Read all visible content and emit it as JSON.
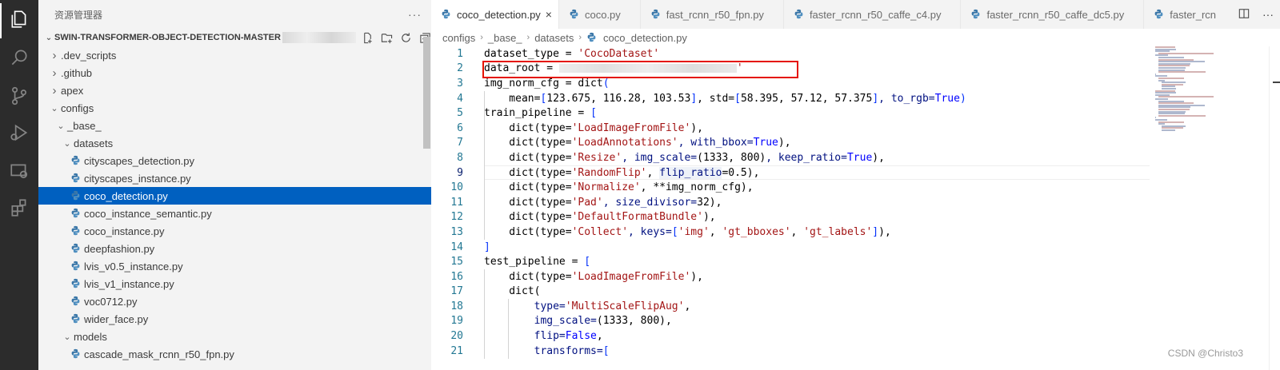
{
  "activity_bar": {
    "icons": [
      "explorer-icon",
      "search-icon",
      "source-control-icon",
      "run-debug-icon",
      "remote-explorer-icon",
      "extensions-icon"
    ]
  },
  "sidebar": {
    "title": "资源管理器",
    "more": "···",
    "project": "SWIN-TRANSFORMER-OBJECT-DETECTION-MASTER",
    "tree": [
      {
        "label": ".dev_scripts",
        "type": "folder",
        "expanded": false,
        "depth": 1
      },
      {
        "label": ".github",
        "type": "folder",
        "expanded": false,
        "depth": 1
      },
      {
        "label": "apex",
        "type": "folder",
        "expanded": false,
        "depth": 1
      },
      {
        "label": "configs",
        "type": "folder",
        "expanded": true,
        "depth": 1
      },
      {
        "label": "_base_",
        "type": "folder",
        "expanded": true,
        "depth": 2
      },
      {
        "label": "datasets",
        "type": "folder",
        "expanded": true,
        "depth": 3
      },
      {
        "label": "cityscapes_detection.py",
        "type": "file",
        "depth": 4
      },
      {
        "label": "cityscapes_instance.py",
        "type": "file",
        "depth": 4
      },
      {
        "label": "coco_detection.py",
        "type": "file",
        "depth": 4,
        "selected": true
      },
      {
        "label": "coco_instance_semantic.py",
        "type": "file",
        "depth": 4
      },
      {
        "label": "coco_instance.py",
        "type": "file",
        "depth": 4
      },
      {
        "label": "deepfashion.py",
        "type": "file",
        "depth": 4
      },
      {
        "label": "lvis_v0.5_instance.py",
        "type": "file",
        "depth": 4
      },
      {
        "label": "lvis_v1_instance.py",
        "type": "file",
        "depth": 4
      },
      {
        "label": "voc0712.py",
        "type": "file",
        "depth": 4
      },
      {
        "label": "wider_face.py",
        "type": "file",
        "depth": 4
      },
      {
        "label": "models",
        "type": "folder",
        "expanded": true,
        "depth": 3
      },
      {
        "label": "cascade_mask_rcnn_r50_fpn.py",
        "type": "file",
        "depth": 4
      }
    ]
  },
  "editor": {
    "tabs": [
      {
        "label": "coco_detection.py",
        "active": true,
        "close": "×"
      },
      {
        "label": "coco.py"
      },
      {
        "label": "fast_rcnn_r50_fpn.py"
      },
      {
        "label": "faster_rcnn_r50_caffe_c4.py"
      },
      {
        "label": "faster_rcnn_r50_caffe_dc5.py"
      },
      {
        "label": "faster_rcn"
      }
    ],
    "tab_actions": [
      "split-editor-icon",
      "more-actions-icon"
    ],
    "breadcrumb": [
      "configs",
      "_base_",
      "datasets",
      "coco_detection.py"
    ],
    "active_line": 9,
    "lines": [
      {
        "n": "1",
        "tokens": [
          [
            "dataset_type = ",
            ""
          ],
          [
            "'CocoDataset'",
            "str"
          ]
        ]
      },
      {
        "n": "2",
        "tokens": [
          [
            "data_root = ",
            ""
          ],
          [
            "",
            "redact"
          ],
          [
            "'",
            "str"
          ]
        ]
      },
      {
        "n": "3",
        "tokens": [
          [
            "img_norm_cfg = dict",
            ""
          ],
          [
            "(",
            "brk"
          ]
        ]
      },
      {
        "n": "4",
        "tokens": [
          [
            "    mean=",
            ""
          ],
          [
            "[",
            "brk"
          ],
          [
            "123.675",
            ""
          ],
          [
            ", ",
            ""
          ],
          [
            "116.28",
            ""
          ],
          [
            ", ",
            ""
          ],
          [
            "103.53",
            ""
          ],
          [
            "]",
            "brk"
          ],
          [
            ", std=",
            ""
          ],
          [
            "[",
            "brk"
          ],
          [
            "58.395",
            ""
          ],
          [
            ", ",
            ""
          ],
          [
            "57.12",
            ""
          ],
          [
            ", ",
            ""
          ],
          [
            "57.375",
            ""
          ],
          [
            "]",
            "brk"
          ],
          [
            ", to_rgb=",
            "prm"
          ],
          [
            "True",
            "kw"
          ],
          [
            ")",
            "brk"
          ]
        ]
      },
      {
        "n": "5",
        "tokens": [
          [
            "train_pipeline = ",
            ""
          ],
          [
            "[",
            "brk"
          ]
        ]
      },
      {
        "n": "6",
        "tokens": [
          [
            "    dict(type=",
            ""
          ],
          [
            "'LoadImageFromFile'",
            "str"
          ],
          [
            "),",
            ""
          ]
        ]
      },
      {
        "n": "7",
        "tokens": [
          [
            "    dict(type=",
            ""
          ],
          [
            "'LoadAnnotations'",
            "str"
          ],
          [
            ", with_bbox=",
            "prm"
          ],
          [
            "True",
            "kw"
          ],
          [
            "),",
            ""
          ]
        ]
      },
      {
        "n": "8",
        "tokens": [
          [
            "    dict(type=",
            ""
          ],
          [
            "'Resize'",
            "str"
          ],
          [
            ", img_scale=",
            "prm"
          ],
          [
            "(1333, 800)",
            ""
          ],
          [
            ", keep_ratio=",
            "prm"
          ],
          [
            "True",
            "kw"
          ],
          [
            "),",
            ""
          ]
        ]
      },
      {
        "n": "9",
        "tokens": [
          [
            "    dict(type=",
            ""
          ],
          [
            "'RandomFlip'",
            "str"
          ],
          [
            ", ",
            ""
          ],
          [
            "flip_ratio",
            "hover"
          ],
          [
            "=0.5),",
            ""
          ]
        ]
      },
      {
        "n": "10",
        "tokens": [
          [
            "    dict(type=",
            ""
          ],
          [
            "'Normalize'",
            "str"
          ],
          [
            ", **img_norm_cfg),",
            ""
          ]
        ]
      },
      {
        "n": "11",
        "tokens": [
          [
            "    dict(type=",
            ""
          ],
          [
            "'Pad'",
            "str"
          ],
          [
            ", size_divisor=",
            "prm"
          ],
          [
            "32",
            ""
          ],
          [
            "),",
            ""
          ]
        ]
      },
      {
        "n": "12",
        "tokens": [
          [
            "    dict(type=",
            ""
          ],
          [
            "'DefaultFormatBundle'",
            "str"
          ],
          [
            "),",
            ""
          ]
        ]
      },
      {
        "n": "13",
        "tokens": [
          [
            "    dict(type=",
            ""
          ],
          [
            "'Collect'",
            "str"
          ],
          [
            ", keys=",
            "prm"
          ],
          [
            "[",
            "brk"
          ],
          [
            "'img'",
            "str"
          ],
          [
            ", ",
            ""
          ],
          [
            "'gt_bboxes'",
            "str"
          ],
          [
            ", ",
            ""
          ],
          [
            "'gt_labels'",
            "str"
          ],
          [
            "]",
            "brk"
          ],
          [
            "),",
            ""
          ]
        ]
      },
      {
        "n": "14",
        "tokens": [
          [
            "]",
            "brk"
          ]
        ]
      },
      {
        "n": "15",
        "tokens": [
          [
            "test_pipeline = ",
            ""
          ],
          [
            "[",
            "brk"
          ]
        ]
      },
      {
        "n": "16",
        "tokens": [
          [
            "    dict(type=",
            ""
          ],
          [
            "'LoadImageFromFile'",
            "str"
          ],
          [
            "),",
            ""
          ]
        ]
      },
      {
        "n": "17",
        "tokens": [
          [
            "    dict(",
            ""
          ]
        ]
      },
      {
        "n": "18",
        "tokens": [
          [
            "        type=",
            "prm"
          ],
          [
            "'MultiScaleFlipAug'",
            "str"
          ],
          [
            ",",
            ""
          ]
        ]
      },
      {
        "n": "19",
        "tokens": [
          [
            "        img_scale=",
            "prm"
          ],
          [
            "(1333, 800)",
            ""
          ],
          [
            ",",
            ""
          ]
        ]
      },
      {
        "n": "20",
        "tokens": [
          [
            "        flip=",
            "prm"
          ],
          [
            "False",
            "kw"
          ],
          [
            ",",
            ""
          ]
        ]
      },
      {
        "n": "21",
        "tokens": [
          [
            "        transforms=",
            "prm"
          ],
          [
            "[",
            "brk"
          ]
        ]
      }
    ]
  },
  "watermark": "CSDN @Christo3",
  "colors": {
    "selection": "#0060c0",
    "highlight_box": "#e51400",
    "string": "#a31515",
    "keyword": "#0000ff"
  }
}
